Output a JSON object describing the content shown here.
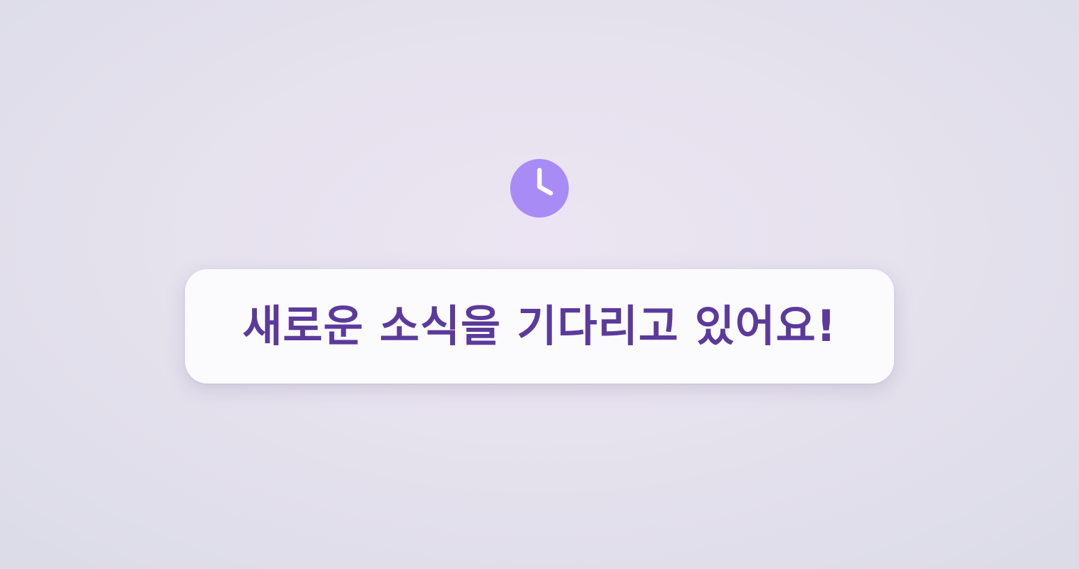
{
  "status_icon": {
    "name": "clock-icon",
    "background_color": "#a98bf6",
    "hand_color": "#ffffff"
  },
  "message": {
    "text": "새로운 소식을 기다리고 있어요!",
    "text_color": "#5c3a9c",
    "card_color": "#fbfbfd"
  }
}
